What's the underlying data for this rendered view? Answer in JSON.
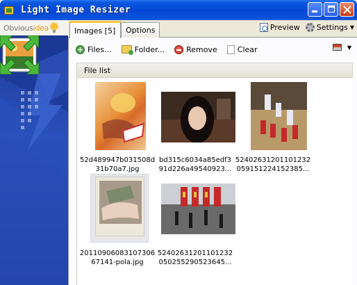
{
  "window": {
    "title": "Light Image Resizer"
  },
  "logo": {
    "text_a": "Obvious",
    "text_b": "idea"
  },
  "tabs": [
    {
      "label": "Images [5]"
    },
    {
      "label": "Options"
    }
  ],
  "header_controls": {
    "preview": "Preview",
    "settings": "Settings"
  },
  "toolbar": {
    "files": "Files...",
    "folder": "Folder...",
    "remove": "Remove",
    "clear": "Clear"
  },
  "file_list": {
    "header": "File list",
    "items": [
      {
        "name_line1": "52d489947b031508d",
        "name_line2": "31b70a7.jpg"
      },
      {
        "name_line1": "bd315c6034a85edf3",
        "name_line2": "91d226a49540923..."
      },
      {
        "name_line1": "52402631201101232",
        "name_line2": "059151224152385..."
      },
      {
        "name_line1": "20110906083107306",
        "name_line2": "67141-pola.jpg"
      },
      {
        "name_line1": "52402631201101232",
        "name_line2": "050255290523645..."
      }
    ]
  },
  "colors": {
    "titlebar": "#0347d4",
    "side_panel": "#2346ad",
    "tab_highlight": "#ffc83c"
  }
}
